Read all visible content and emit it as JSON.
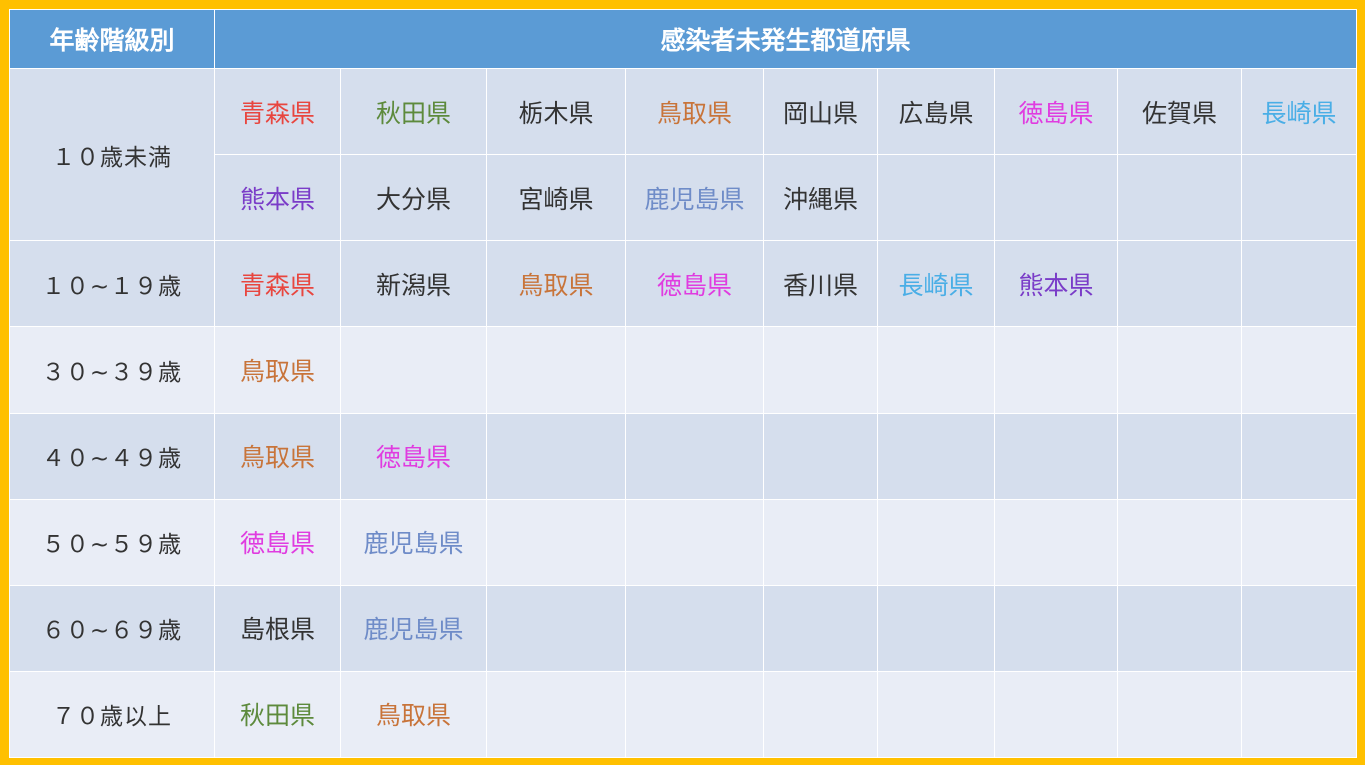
{
  "header": {
    "age_group": "年齢階級別",
    "prefectures": "感染者未発生都道府県"
  },
  "colors": {
    "black": "#333333",
    "red": "#e8463f",
    "green": "#5d8a3c",
    "orange": "#c8743a",
    "magenta": "#e03ce0",
    "sky": "#4aaee6",
    "purple": "#7a3cc8",
    "steel": "#6f8cc8"
  },
  "rows": [
    {
      "age": "１０歳未満",
      "band": "a",
      "prefs": [
        {
          "name": "青森県",
          "color": "red"
        },
        {
          "name": "秋田県",
          "color": "green"
        },
        {
          "name": "栃木県",
          "color": "black"
        },
        {
          "name": "鳥取県",
          "color": "orange"
        },
        {
          "name": "岡山県",
          "color": "black"
        },
        {
          "name": "広島県",
          "color": "black"
        },
        {
          "name": "徳島県",
          "color": "magenta"
        },
        {
          "name": "佐賀県",
          "color": "black"
        },
        {
          "name": "長崎県",
          "color": "sky"
        }
      ],
      "prefs2": [
        {
          "name": "熊本県",
          "color": "purple"
        },
        {
          "name": "大分県",
          "color": "black"
        },
        {
          "name": "宮崎県",
          "color": "black"
        },
        {
          "name": "鹿児島県",
          "color": "steel"
        },
        {
          "name": "沖縄県",
          "color": "black"
        }
      ]
    },
    {
      "age": "１０~１９歳",
      "band": "a",
      "prefs": [
        {
          "name": "青森県",
          "color": "red"
        },
        {
          "name": "新潟県",
          "color": "black"
        },
        {
          "name": "鳥取県",
          "color": "orange"
        },
        {
          "name": "徳島県",
          "color": "magenta"
        },
        {
          "name": "香川県",
          "color": "black"
        },
        {
          "name": "長崎県",
          "color": "sky"
        },
        {
          "name": "熊本県",
          "color": "purple"
        }
      ]
    },
    {
      "age": "３０~３９歳",
      "band": "b",
      "prefs": [
        {
          "name": "鳥取県",
          "color": "orange"
        }
      ]
    },
    {
      "age": "４０~４９歳",
      "band": "a",
      "prefs": [
        {
          "name": "鳥取県",
          "color": "orange"
        },
        {
          "name": "徳島県",
          "color": "magenta"
        }
      ]
    },
    {
      "age": "５０~５９歳",
      "band": "b",
      "prefs": [
        {
          "name": "徳島県",
          "color": "magenta"
        },
        {
          "name": "鹿児島県",
          "color": "steel"
        }
      ]
    },
    {
      "age": "６０~６９歳",
      "band": "a",
      "prefs": [
        {
          "name": "島根県",
          "color": "black"
        },
        {
          "name": "鹿児島県",
          "color": "steel"
        }
      ]
    },
    {
      "age": "７０歳以上",
      "band": "b",
      "prefs": [
        {
          "name": "秋田県",
          "color": "green"
        },
        {
          "name": "鳥取県",
          "color": "orange"
        }
      ]
    }
  ]
}
